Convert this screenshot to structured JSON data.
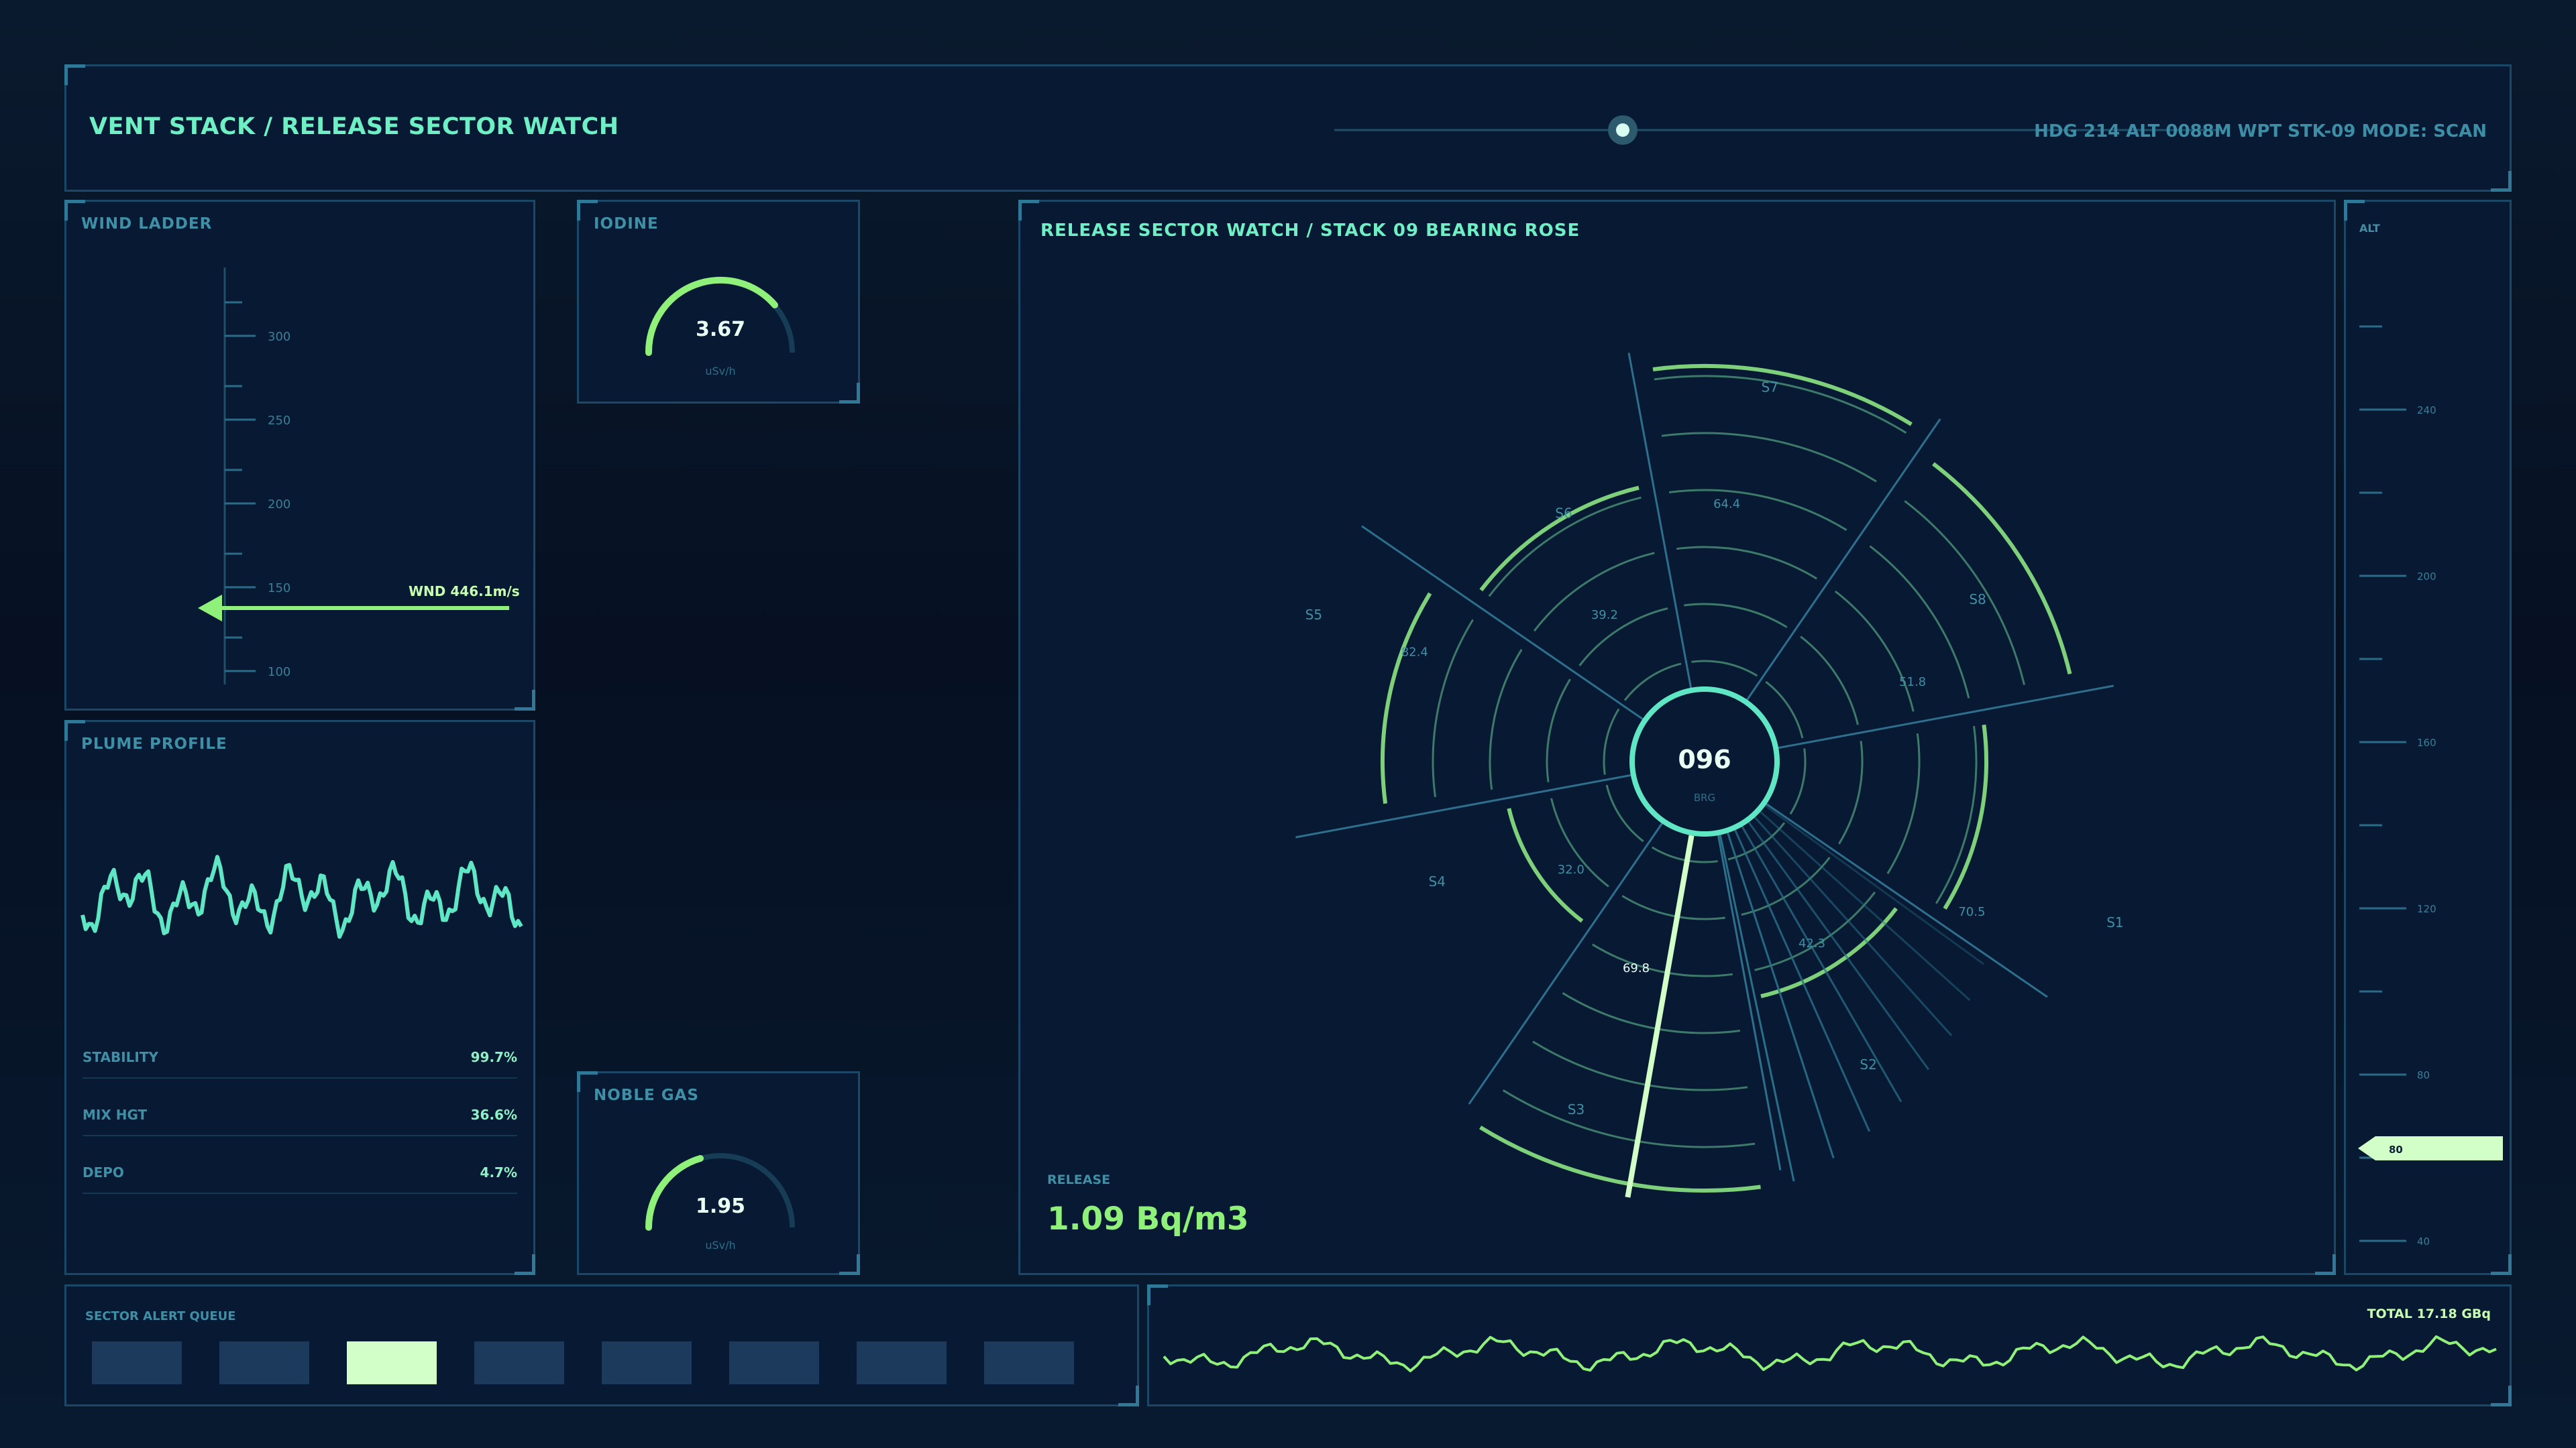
{
  "header": {
    "title": "VENT STACK / RELEASE SECTOR WATCH",
    "status": "HDG 214  ALT 0088M  WPT STK-09  MODE: SCAN"
  },
  "wind_ladder": {
    "title": "WIND LADDER",
    "ticks": [
      "300",
      "250",
      "200",
      "150",
      "100"
    ],
    "indicator": "WND 446.1m/s"
  },
  "iodine": {
    "title": "IODINE",
    "value": "3.67",
    "unit": "uSv/h",
    "fill": 0.78
  },
  "noble_gas": {
    "title": "NOBLE GAS",
    "value": "1.95",
    "unit": "uSv/h",
    "fill": 0.42
  },
  "plume": {
    "title": "PLUME PROFILE",
    "metrics": [
      {
        "label": "STABILITY",
        "value": "99.7%"
      },
      {
        "label": "MIX HGT",
        "value": "36.6%"
      },
      {
        "label": "DEPO",
        "value": "4.7%"
      }
    ]
  },
  "rose": {
    "title": "RELEASE SECTOR WATCH / STACK 09  BEARING ROSE",
    "center_value": "096",
    "center_label": "BRG",
    "sectors": [
      "S1",
      "S2",
      "S3",
      "S4",
      "S5",
      "S6",
      "S7",
      "S8"
    ],
    "values": [
      "70.5",
      "42.3",
      "69.8",
      "32.0",
      "82.4",
      "39.2",
      "64.4",
      "51.8"
    ],
    "release_label": "RELEASE",
    "release_value": "1.09 Bq/m3"
  },
  "alt_tape": {
    "title": "ALT",
    "ticks": [
      "240",
      "200",
      "160",
      "120",
      "80",
      "40"
    ],
    "current": "80"
  },
  "alert_queue": {
    "title": "SECTOR ALERT QUEUE",
    "tiles": 8,
    "active_index": 2
  },
  "total": {
    "label": "TOTAL 17.18 GBq"
  },
  "colors": {
    "accent": "#8ff07a",
    "teal": "#5fe6c4",
    "frame": "#1b4866",
    "dim": "#3f8fa6"
  }
}
